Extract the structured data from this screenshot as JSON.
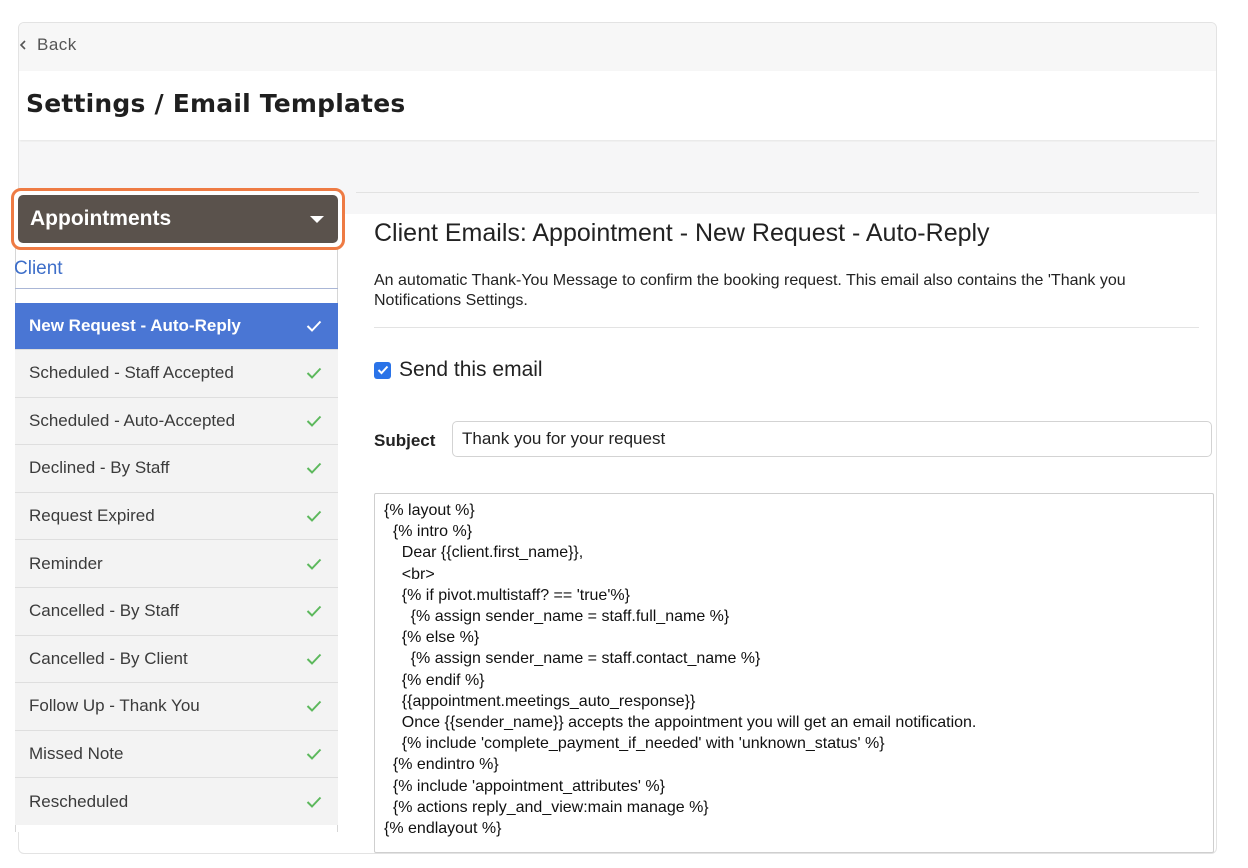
{
  "nav": {
    "back_label": "Back"
  },
  "page": {
    "title": "Settings / Email Templates"
  },
  "sidebar": {
    "dropdown_label": "Appointments",
    "group_label": "Client",
    "items": [
      {
        "label": "New Request - Auto-Reply",
        "active": true
      },
      {
        "label": "Scheduled - Staff Accepted"
      },
      {
        "label": "Scheduled - Auto-Accepted"
      },
      {
        "label": "Declined - By Staff"
      },
      {
        "label": "Request Expired"
      },
      {
        "label": "Reminder"
      },
      {
        "label": "Cancelled - By Staff"
      },
      {
        "label": "Cancelled - By Client"
      },
      {
        "label": "Follow Up - Thank You"
      },
      {
        "label": "Missed Note"
      },
      {
        "label": "Rescheduled"
      }
    ]
  },
  "main": {
    "title": "Client Emails: Appointment - New Request - Auto-Reply",
    "description": "An automatic Thank-You Message to confirm the booking request. This email also contains the 'Thank you Notifications Settings.",
    "send_email_label": "Send this email",
    "send_email_checked": true,
    "subject_label": "Subject",
    "subject_value": "Thank you for your request",
    "body_value": "{% layout %}\n  {% intro %}\n    Dear {{client.first_name}},\n    <br>\n    {% if pivot.multistaff? == 'true'%}\n      {% assign sender_name = staff.full_name %}\n    {% else %}\n      {% assign sender_name = staff.contact_name %}\n    {% endif %}\n    {{appointment.meetings_auto_response}}\n    Once {{sender_name}} accepts the appointment you will get an email notification.\n    {% include 'complete_payment_if_needed' with 'unknown_status' %}\n  {% endintro %}\n  {% include 'appointment_attributes' %}\n  {% actions reply_and_view:main manage %}\n{% endlayout %}"
  },
  "colors": {
    "accent": "#4a76d4",
    "dropdown_bg": "#5a524c",
    "highlight_border": "#ee7b44",
    "check_green": "#5cb85c",
    "checkbox_blue": "#2a73e8",
    "group_label": "#3d6ec9"
  },
  "icons": {
    "back": "chevron-left-icon",
    "dropdown": "caret-down-icon",
    "item_status": "checkmark-icon"
  }
}
